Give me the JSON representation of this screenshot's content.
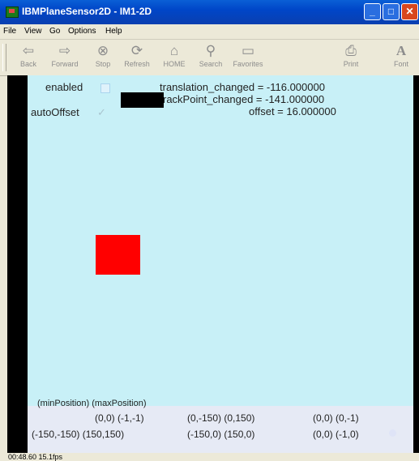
{
  "window": {
    "title": "IBMPlaneSensor2D - IM1-2D",
    "buttons": {
      "minimize": "_",
      "maximize": "□",
      "close": "✕"
    }
  },
  "menu": {
    "items": [
      "File",
      "View",
      "Go",
      "Options",
      "Help"
    ]
  },
  "toolbar": {
    "buttons": [
      {
        "label": "Back",
        "icon": "⇦"
      },
      {
        "label": "Forward",
        "icon": "⇨"
      },
      {
        "label": "Stop",
        "icon": "⊗"
      },
      {
        "label": "Refresh",
        "icon": "⟳"
      },
      {
        "label": "HOME",
        "icon": "⌂"
      },
      {
        "label": "Search",
        "icon": "⚲"
      },
      {
        "label": "Favorites",
        "icon": "▭"
      },
      {
        "label": "Print",
        "icon": "⎙"
      },
      {
        "label": "Font",
        "icon": "A"
      }
    ]
  },
  "scene": {
    "enabled_label": "enabled",
    "auto_offset_label": "autoOffset",
    "translation_changed": "translation_changed = -116.000000",
    "track_point_changed": "rackPoint_changed = -141.000000",
    "offset": "offset = 16.000000",
    "position_header": "(minPosition) (maxPosition)",
    "positions": {
      "row1": [
        "(0,0) (-1,-1)",
        "(0,-150) (0,150)",
        "(0,0) (0,-1)"
      ],
      "row2": [
        "(-150,-150) (150,150)",
        "(-150,0) (150,0)",
        "(0,0) (-1,0)"
      ]
    },
    "square_color": "#ff0000",
    "background_color": "#c8f0f7"
  },
  "status": {
    "text": "00:48.60  15.1fps"
  }
}
